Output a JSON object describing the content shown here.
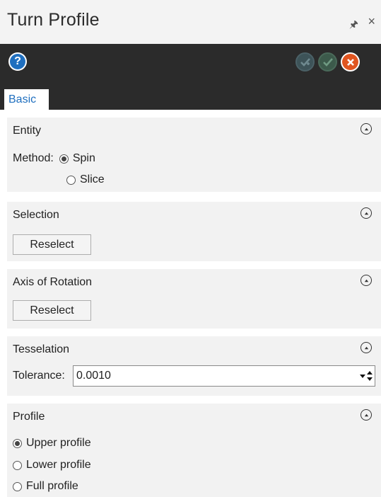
{
  "window": {
    "title": "Turn Profile",
    "pin_icon": "pin-icon",
    "close_icon": "close-icon"
  },
  "toolbar": {
    "help": "?",
    "tab": "Basic"
  },
  "entity": {
    "title": "Entity",
    "method_label": "Method:",
    "options": [
      "Spin",
      "Slice"
    ],
    "selected": "Spin"
  },
  "selection": {
    "title": "Selection",
    "button": "Reselect"
  },
  "axis": {
    "title": "Axis of Rotation",
    "button": "Reselect"
  },
  "tesselation": {
    "title": "Tesselation",
    "tolerance_label": "Tolerance:",
    "tolerance_value": "0.0010"
  },
  "profile": {
    "title": "Profile",
    "options": [
      "Upper profile",
      "Lower profile",
      "Full profile"
    ],
    "selected": "Upper profile"
  },
  "colors": {
    "toolbar_bg": "#2b2b2b",
    "accent": "#1f6fbf",
    "cancel": "#e05520"
  }
}
